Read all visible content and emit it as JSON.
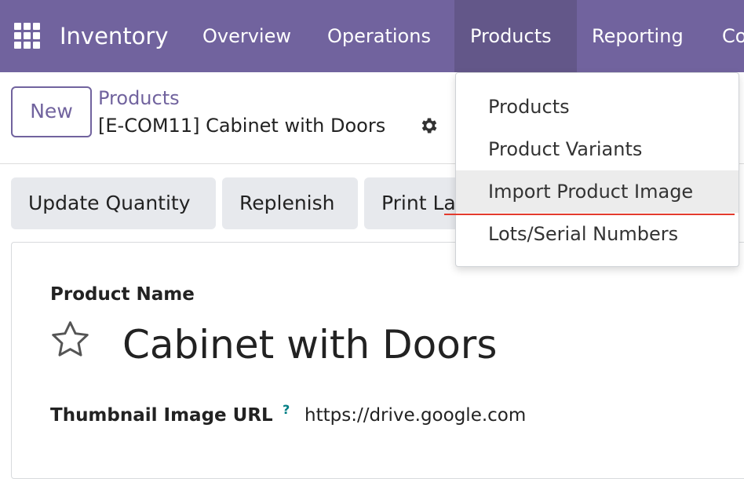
{
  "navbar": {
    "app_name": "Inventory",
    "menu": [
      {
        "label": "Overview"
      },
      {
        "label": "Operations"
      },
      {
        "label": "Products",
        "active": true
      },
      {
        "label": "Reporting"
      },
      {
        "label": "Co"
      }
    ],
    "color": "#71639e",
    "active_color": "#635789",
    "icon": "apps-grid-icon"
  },
  "control_panel": {
    "new_label": "New",
    "breadcrumb_parent": "Products",
    "breadcrumb_current": "[E-COM11] Cabinet with Doors",
    "settings_icon": "gear-icon"
  },
  "actions": {
    "update_quantity": "Update Quantity",
    "replenish": "Replenish",
    "print_labels": "Print La"
  },
  "form": {
    "name_label": "Product Name",
    "name_value": "Cabinet with Doors",
    "favorite_icon": "star-outline-icon",
    "thumbnail_label": "Thumbnail Image URL",
    "thumbnail_help": "?",
    "thumbnail_value": "https://drive.google.com"
  },
  "dropdown": {
    "items": [
      {
        "label": "Products"
      },
      {
        "label": "Product Variants"
      },
      {
        "label": "Import Product Image",
        "highlighted": true
      },
      {
        "label": "Lots/Serial Numbers"
      }
    ],
    "annotation_color": "#e33b2e"
  }
}
